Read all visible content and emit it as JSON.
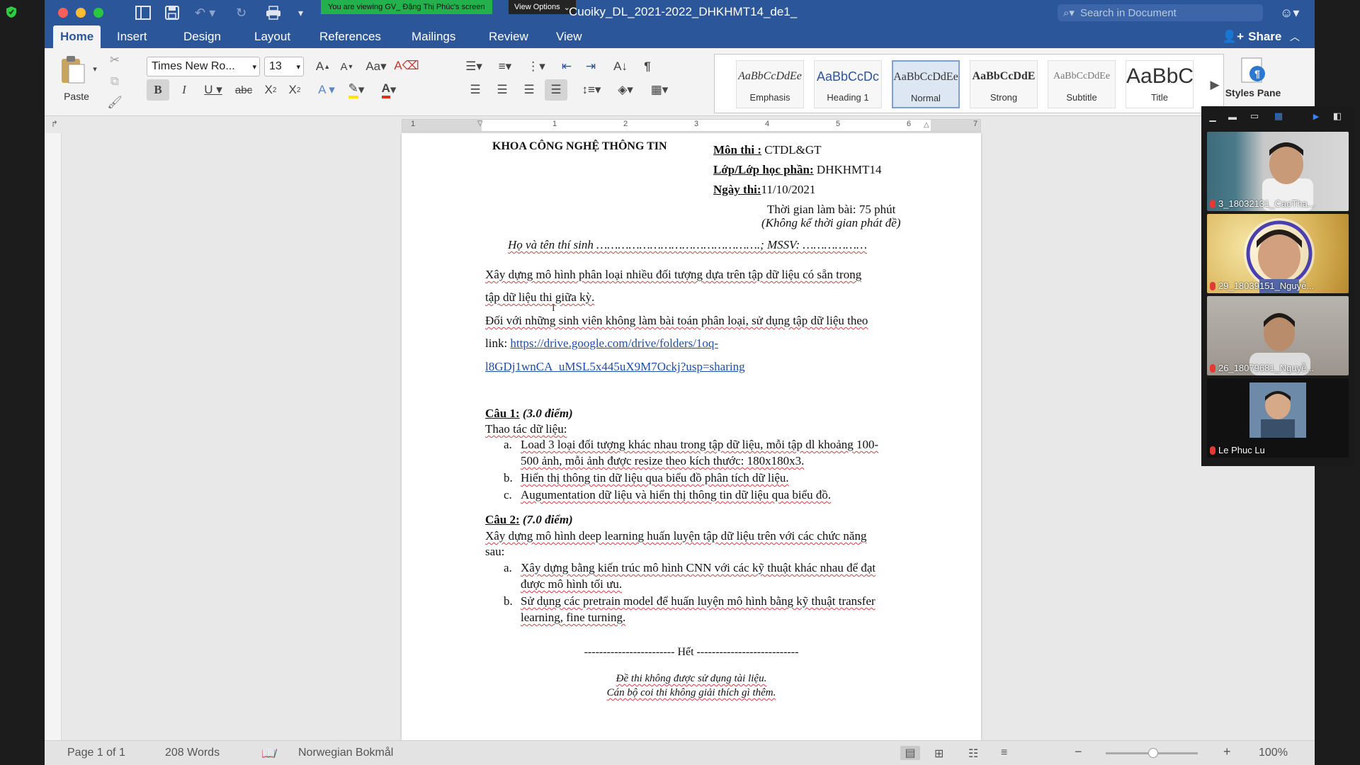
{
  "screen_share": {
    "banner": "You are viewing GV_ Đặng Thị Phúc's screen",
    "view_options": "View Options"
  },
  "window": {
    "title": "Cuoiky_DL_2021-2022_DHKHMT14_de1_",
    "search_placeholder": "Search in Document",
    "share": "Share"
  },
  "tabs": [
    "Home",
    "Insert",
    "Design",
    "Layout",
    "References",
    "Mailings",
    "Review",
    "View"
  ],
  "ribbon": {
    "paste": "Paste",
    "font_name": "Times New Ro...",
    "font_size": "13",
    "styles_pane": "Styles Pane",
    "styles": [
      {
        "sample": "AaBbCcDdEe",
        "name": "Emphasis"
      },
      {
        "sample": "AaBbCcDc",
        "name": "Heading 1"
      },
      {
        "sample": "AaBbCcDdEe",
        "name": "Normal"
      },
      {
        "sample": "AaBbCcDdE",
        "name": "Strong"
      },
      {
        "sample": "AaBbCcDdEe",
        "name": "Subtitle"
      },
      {
        "sample": "AaBbC",
        "name": "Title"
      }
    ]
  },
  "ruler": {
    "numbers": [
      "1",
      "1",
      "2",
      "3",
      "4",
      "5",
      "6",
      "7"
    ]
  },
  "document": {
    "faculty": "KHOA CÔNG NGHỆ THÔNG TIN",
    "subject_label": "Môn thi :",
    "subject_value": " CTDL&GT",
    "class_label": "Lớp/Lớp học phần:",
    "class_value": " DHKHMT14",
    "date_label": "Ngày thi:",
    "date_value": "11/10/2021",
    "duration": "Thời gian làm bài: 75 phút",
    "duration_note": "(Không kể thời gian phát đề)",
    "student_line": "Họ và tên thí sinh ……………………………………….; MSSV: ………………",
    "intro_1": "Xây dựng mô hình phân loại nhiều đối tượng dựa trên tập dữ liệu có sẵn trong",
    "intro_2": "tập dữ liệu thi giữa kỳ.",
    "intro_3": "Đối với những sinh viên không làm bài toán phân loại, sử dụng tập dữ liệu theo",
    "link_prefix": "link: ",
    "link_1": "https://drive.google.com/drive/folders/1oq-",
    "link_2": "l8GDj1wnCA_uMSL5x445uX9M7Ockj?usp=sharing",
    "q1_label": "Câu 1:",
    "q1_points": " (3.0 điểm)",
    "q1_intro": "Thao tác dữ liệu:",
    "q1_a_marker": "a.",
    "q1_a_1": "Load 3 loại đối tượng khác nhau trong tập dữ liệu, mỗi tập dl khoảng 100-",
    "q1_a_2": "500 ảnh, mỗi ảnh được resize theo kích thước: 180x180x3.",
    "q1_b_marker": "b.",
    "q1_b": "Hiển thị thông tin dữ liệu qua biểu đồ phân tích dữ liệu.",
    "q1_c_marker": "c.",
    "q1_c": "Augumentation dữ liệu và hiển thị thông tin dữ liệu qua biểu đồ.",
    "q2_label": "Câu 2:",
    "q2_points": " (7.0  điểm)",
    "q2_intro_1": "Xây dựng mô hình deep learning huấn luyện tập dữ liệu trên với các chức năng",
    "q2_intro_2": "sau:",
    "q2_a_marker": "a.",
    "q2_a_1": "Xây dựng bằng kiến trúc mô hình CNN với các kỹ thuật khác nhau để đạt",
    "q2_a_2": "được mô hình tối ưu.",
    "q2_b_marker": "b.",
    "q2_b_1": "Sử dụng các pretrain model để huấn luyện mô hình bằng kỹ thuật transfer",
    "q2_b_2": "learning, fine turning.",
    "end_line": "------------------------ Hết ---------------------------",
    "footer_1": "Đề thi không được sử dụng tài liệu.",
    "footer_2": "Cán bộ coi thi không giải thích gì thêm."
  },
  "status_bar": {
    "page": "Page 1 of 1",
    "words": "208 Words",
    "language": "Norwegian Bokmål",
    "zoom": "100%"
  },
  "participants": [
    {
      "name": "3_18032131_CaoTha..."
    },
    {
      "name": "29_18039151_Nguyễ..."
    },
    {
      "name": "26_18079681_Nguyễ..."
    },
    {
      "name": "Le Phuc Lu"
    }
  ],
  "colors": {
    "word_blue": "#2b579a",
    "banner_green": "#22b14c",
    "spell_red": "#d24141",
    "link_blue": "#1f4ea8"
  }
}
